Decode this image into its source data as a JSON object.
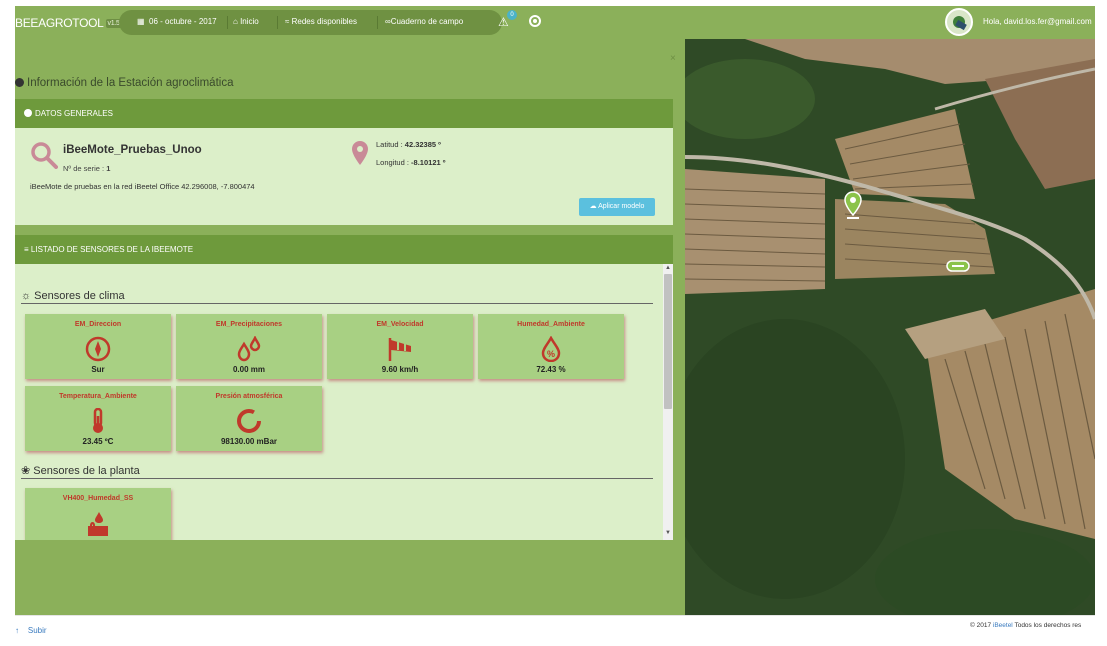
{
  "app": {
    "brand": "BEEAGROTOOL",
    "version": "v1.5"
  },
  "nav": {
    "date_label": "06 - octubre - 2017",
    "home_label": "Inicio",
    "networks_label": "Redes disponibles",
    "field_notebook_label": "Cuaderno de campo",
    "alert_count": "0"
  },
  "user": {
    "greeting": "Hola, david.los.fer@gmail.com"
  },
  "panel": {
    "title": "Información de la Estación agroclimática",
    "general_header": "DATOS GENERALES",
    "station_name": "iBeeMote_Pruebas_Unoo",
    "serial_label": "Nº de serie :",
    "serial_value": "1",
    "description": "iBeeMote de pruebas en la red iBeetel Office 42.296008, -7.800474",
    "latitude_label": "Latitud :",
    "latitude_value": "42.32385 º",
    "longitude_label": "Longitud :",
    "longitude_value": "-8.10121 º",
    "apply_model_label": "Aplicar modelo",
    "sensors_header": "LISTADO DE SENSORES DE LA IBEEMOTE"
  },
  "groups": {
    "climate_title": "Sensores de clima",
    "plant_title": "Sensores de la planta"
  },
  "sensors": [
    {
      "name": "EM_Direccion",
      "value": "Sur",
      "icon": "compass-icon"
    },
    {
      "name": "EM_Precipitaciones",
      "value": "0.00 mm",
      "icon": "raindrops-icon"
    },
    {
      "name": "EM_Velocidad",
      "value": "9.60 km/h",
      "icon": "windsock-icon"
    },
    {
      "name": "Humedad_Ambiente",
      "value": "72.43 %",
      "icon": "humidity-drop-icon"
    },
    {
      "name": "Temperatura_Ambiente",
      "value": "23.45 ºC",
      "icon": "thermometer-icon"
    },
    {
      "name": "Presión atmosférica",
      "value": "98130.00 mBar",
      "icon": "pressure-gauge-icon"
    },
    {
      "name": "VH400_Humedad_SS",
      "value": "",
      "icon": "soil-moisture-icon"
    }
  ],
  "footer": {
    "scroll_top_label": "Subir",
    "copyright_prefix": "© 2017",
    "copyright_link": "iBeetel",
    "copyright_suffix": "Todos los derechos res"
  },
  "colors": {
    "topbar": "#8bb05a",
    "header_dark": "#6e9a3c",
    "card_bg": "#dcefc9",
    "sensor_tile": "#a8d083",
    "sensor_label": "#c0392b",
    "icon_pink": "#c98a97",
    "button_info": "#5bc0de"
  }
}
